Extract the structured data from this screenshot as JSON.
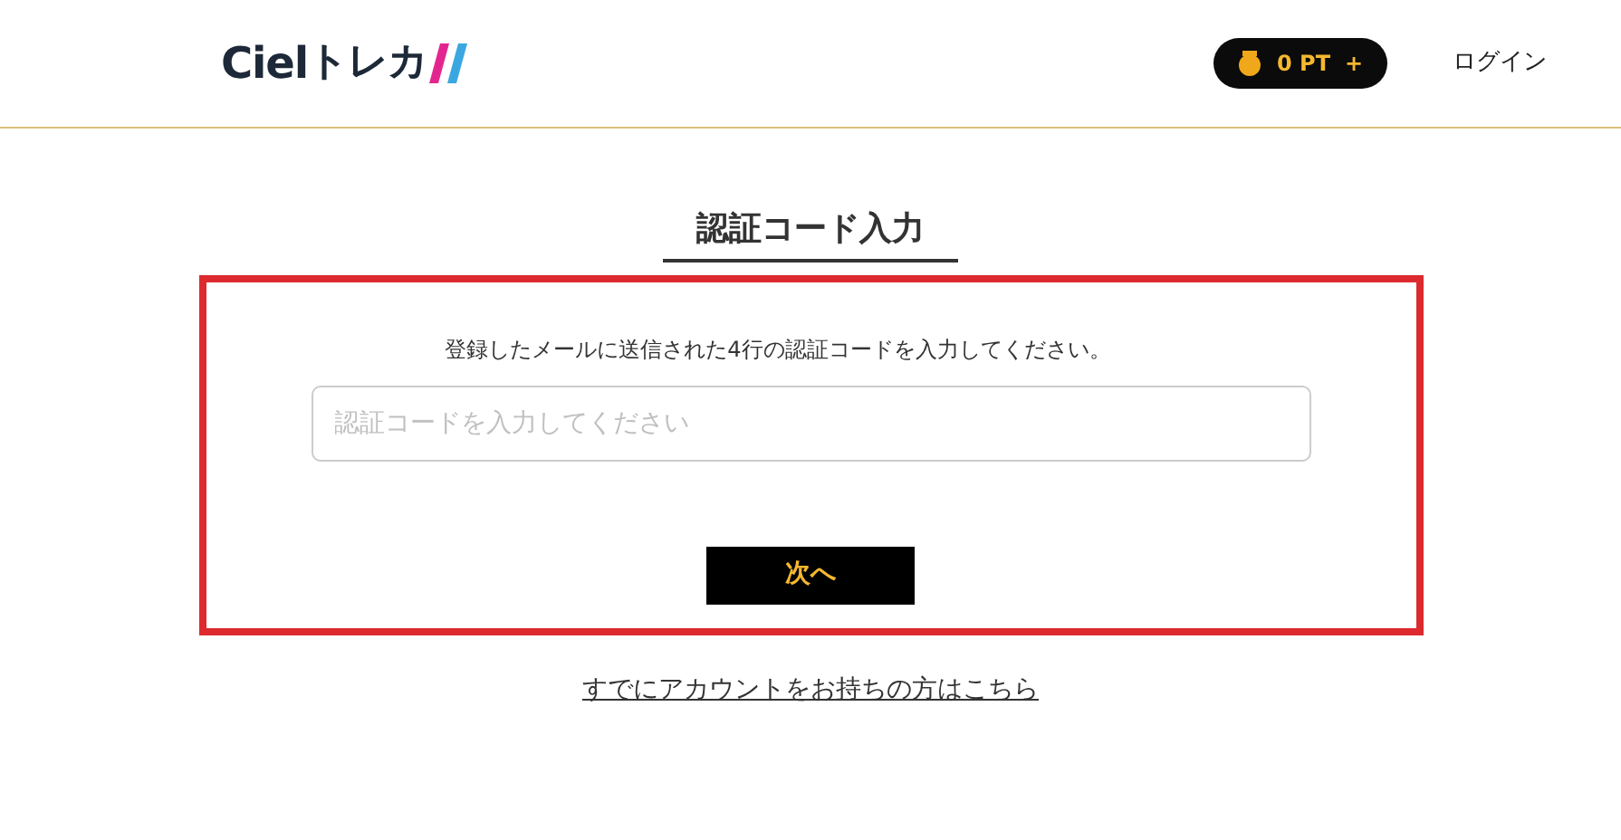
{
  "header": {
    "logo": {
      "primary": "Ciel",
      "secondary": "トレカ"
    },
    "points": {
      "value": "0 PT",
      "add": "+"
    },
    "login": "ログイン"
  },
  "title": "認証コード入力",
  "form": {
    "message": "登録したメールに送信された4行の認証コードを入力してください。",
    "input": {
      "placeholder": "認証コードを入力してください"
    },
    "submit": "次へ"
  },
  "footer_link": "すでにアカウントをお持ちの方はこちら"
}
